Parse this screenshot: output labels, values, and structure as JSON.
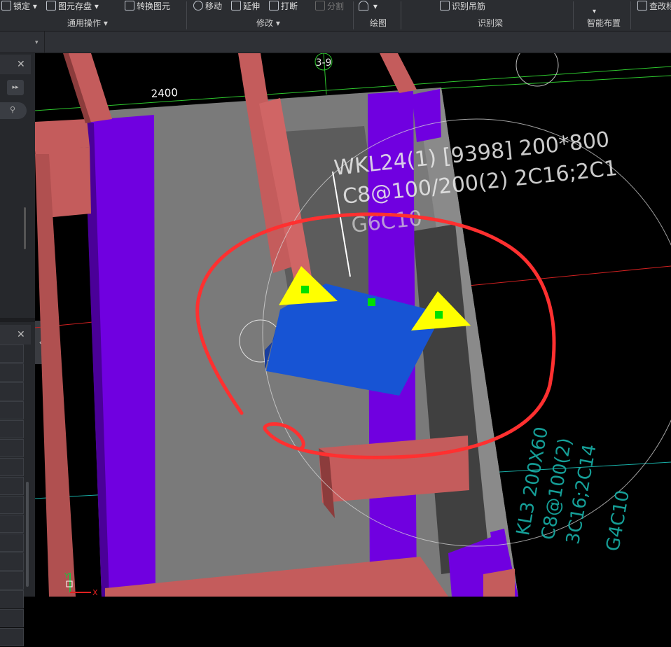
{
  "ribbon": {
    "lock": "锁定",
    "save_element": "图元存盘",
    "convert_element": "转换图元",
    "move": "移动",
    "extend": "延伸",
    "break": "打断",
    "split": "分割",
    "identify_hanger": "识别吊筋",
    "check_change": "查改标",
    "groups": {
      "general": "通用操作",
      "modify": "修改",
      "draw": "绘图",
      "identify_beam": "识别梁",
      "smart_layout": "智能布置"
    }
  },
  "viewport": {
    "axis_label": "3-9",
    "dimension": "2400",
    "beam_annotation": {
      "line1": "WKL24(1) [9398] 200*800",
      "line2": "C8@100/200(2) 2C16;2C1",
      "line3": "G6C10"
    },
    "cad_text": {
      "line1": "KL3 200X60",
      "line2": "C8@100(2)",
      "line3": "3C16;2C14",
      "line4": "G4C10"
    },
    "axis_x": "X",
    "axis_y": "Y"
  },
  "colors": {
    "beam_red": "#c45c5c",
    "beam_purple": "#7000e0",
    "slab_gray": "#7a7a7a",
    "selected_blue": "#1754d4",
    "grip_yellow": "#ffff00",
    "grip_green": "#00e000",
    "markup_red": "#ff3030",
    "cad_cyan": "#18b0a8"
  }
}
